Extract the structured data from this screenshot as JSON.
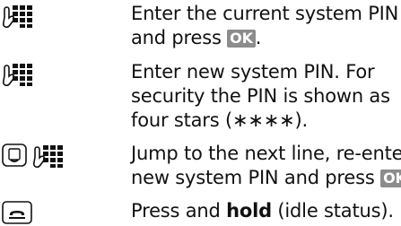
{
  "steps": [
    {
      "icons": [
        "keypad-icon"
      ],
      "line1": "Enter the current system PIN",
      "line2_pre": "and press ",
      "key": "OK",
      "line2_post": "."
    },
    {
      "icons": [
        "keypad-icon"
      ],
      "line1": "Enter new system PIN. For",
      "line2": "security the PIN is shown as",
      "line3": "four stars (∗∗∗∗)."
    },
    {
      "icons": [
        "navigation-key-down-icon",
        "keypad-icon"
      ],
      "line1": "Jump to the next line, re-enter",
      "line2_pre": "new system PIN and press ",
      "key": "OK",
      "line2_post": "."
    },
    {
      "icons": [
        "end-call-key-icon"
      ],
      "line1_pre": "Press and ",
      "line1_bold": "hold",
      "line1_post": " (idle status)."
    }
  ]
}
